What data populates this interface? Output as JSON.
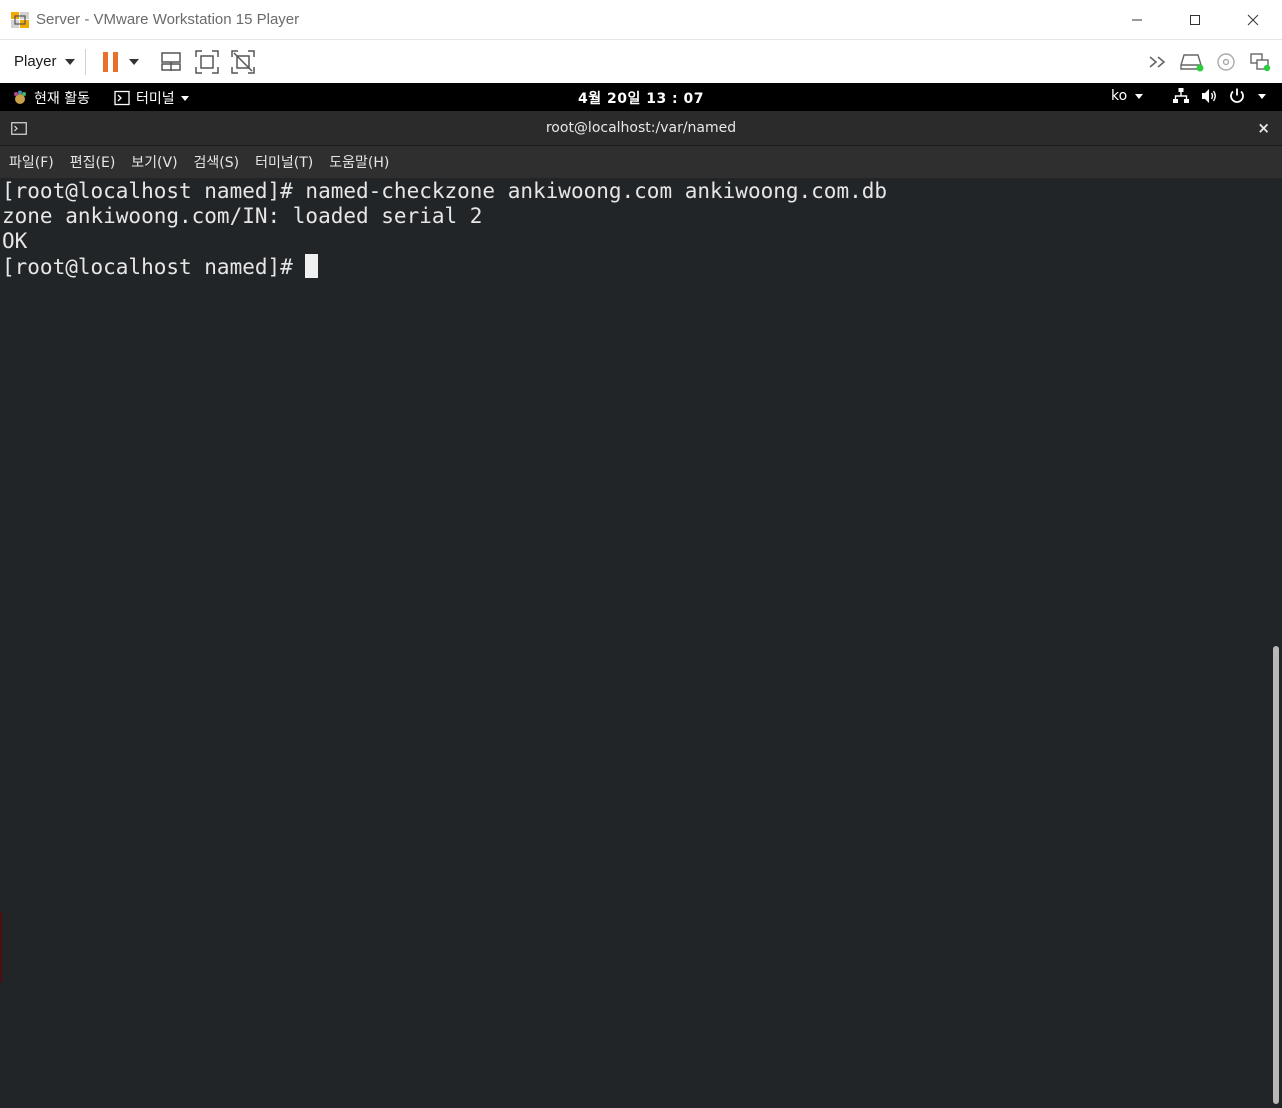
{
  "window": {
    "title": "Server - VMware Workstation 15 Player"
  },
  "toolbar": {
    "player_label": "Player"
  },
  "gnome_bar": {
    "activities": "현재 활동",
    "app_menu": "터미널",
    "clock": "4월 20일  13 : 07",
    "language": "ko"
  },
  "terminal": {
    "title": "root@localhost:/var/named",
    "close": "×",
    "menu": [
      "파일(F)",
      "편집(E)",
      "보기(V)",
      "검색(S)",
      "터미널(T)",
      "도움말(H)"
    ],
    "lines": [
      "[root@localhost named]# named-checkzone ankiwoong.com ankiwoong.com.db",
      "zone ankiwoong.com/IN: loaded serial 2",
      "OK"
    ],
    "prompt": "[root@localhost named]# "
  },
  "colors": {
    "pause_orange": "#e8702a",
    "terminal_bg": "#222527",
    "status_green": "#2ecc40"
  }
}
